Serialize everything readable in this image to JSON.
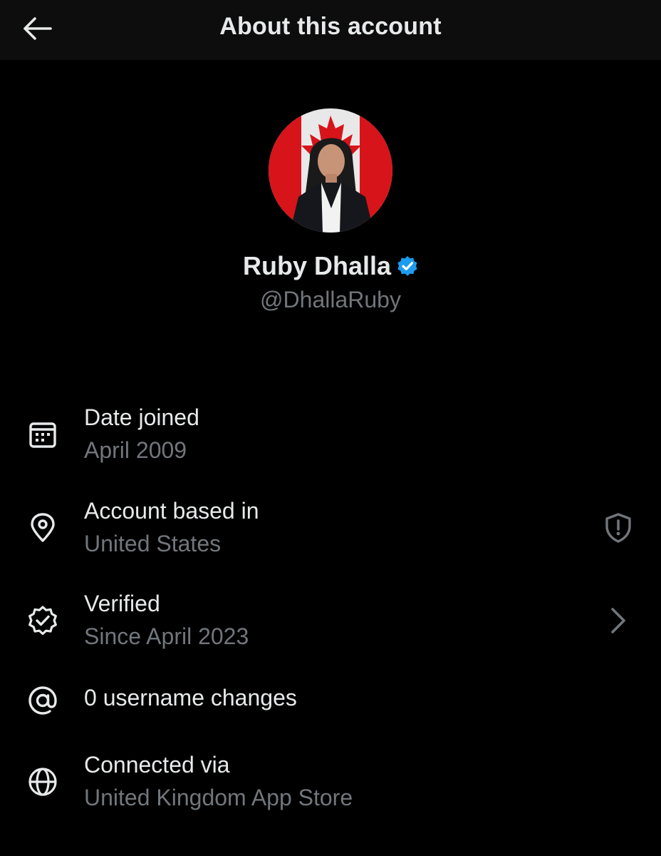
{
  "header": {
    "title": "About this account",
    "back_icon": "arrow-left-icon"
  },
  "profile": {
    "avatar_icon": "profile-avatar",
    "name": "Ruby Dhalla",
    "verified_badge": "verified-badge-icon",
    "handle": "@DhallaRuby"
  },
  "details": {
    "date_joined": {
      "icon": "calendar-icon",
      "label": "Date joined",
      "value": "April 2009"
    },
    "account_based_in": {
      "icon": "location-pin-icon",
      "label": "Account based in",
      "value": "United States",
      "right_icon": "shield-alert-icon"
    },
    "verified": {
      "icon": "verified-check-icon",
      "label": "Verified",
      "value": "Since April 2023",
      "right_icon": "chevron-right-icon"
    },
    "username_changes": {
      "icon": "at-sign-icon",
      "label": "0 username changes"
    },
    "connected_via": {
      "icon": "globe-icon",
      "label": "Connected via",
      "value": "United Kingdom App Store"
    }
  },
  "colors": {
    "background": "#000000",
    "header_background": "#0d0d0d",
    "primary_text": "#e7e9ea",
    "secondary_text": "#71767b",
    "verified_blue": "#1d9bf0"
  }
}
